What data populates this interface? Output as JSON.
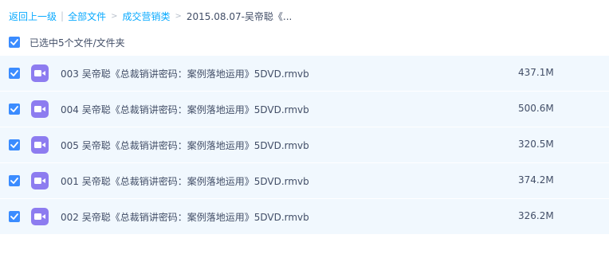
{
  "breadcrumb": {
    "back_label": "返回上一级",
    "separator": "|",
    "items": [
      {
        "label": "全部文件"
      },
      {
        "label": "成交营销类"
      }
    ],
    "arrow": ">",
    "current": "2015.08.07-吴帝聪《..."
  },
  "selection": {
    "checked": true,
    "label": "已选中5个文件/文件夹"
  },
  "colors": {
    "accent": "#09aaff",
    "checkbox": "#3b8cff",
    "row_bg": "#f1f8fe",
    "video_icon": "#8d7cf0"
  },
  "files": [
    {
      "name": "003 吴帝聪《总裁销讲密码：案例落地运用》5DVD.rmvb",
      "size": "437.1M",
      "checked": true,
      "icon": "video-file-icon"
    },
    {
      "name": "004 吴帝聪《总裁销讲密码：案例落地运用》5DVD.rmvb",
      "size": "500.6M",
      "checked": true,
      "icon": "video-file-icon"
    },
    {
      "name": "005 吴帝聪《总裁销讲密码：案例落地运用》5DVD.rmvb",
      "size": "320.5M",
      "checked": true,
      "icon": "video-file-icon"
    },
    {
      "name": "001 吴帝聪《总裁销讲密码：案例落地运用》5DVD.rmvb",
      "size": "374.2M",
      "checked": true,
      "icon": "video-file-icon"
    },
    {
      "name": "002 吴帝聪《总裁销讲密码：案例落地运用》5DVD.rmvb",
      "size": "326.2M",
      "checked": true,
      "icon": "video-file-icon"
    }
  ]
}
